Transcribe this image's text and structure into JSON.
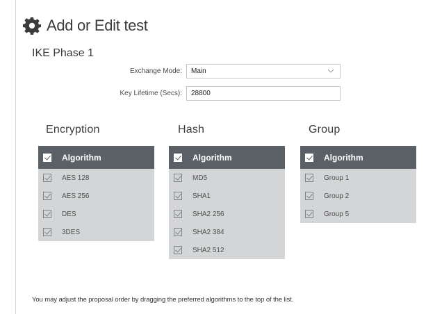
{
  "page": {
    "title": "Add or Edit test",
    "section_title": "IKE Phase 1",
    "footer_note": "You may adjust the proposal order by dragging the preferred algorithms to the top of the list."
  },
  "fields": {
    "exchange_mode_label": "Exchange Mode:",
    "exchange_mode_value": "Main",
    "key_lifetime_label": "Key Lifetime (Secs):",
    "key_lifetime_value": "28800"
  },
  "groups": {
    "encryption": {
      "heading": "Encryption",
      "column_header": "Algorithm",
      "items": [
        "AES 128",
        "AES 256",
        "DES",
        "3DES"
      ]
    },
    "hash": {
      "heading": "Hash",
      "column_header": "Algorithm",
      "items": [
        "MD5",
        "SHA1",
        "SHA2 256",
        "SHA2 384",
        "SHA2 512"
      ]
    },
    "group": {
      "heading": "Group",
      "column_header": "Algorithm",
      "items": [
        "Group 1",
        "Group 2",
        "Group 5"
      ]
    }
  },
  "icons": {
    "title": "gear-icon",
    "dropdown": "chevron-down-icon",
    "checkbox": "checkbox-checked-icon"
  },
  "colors": {
    "table_header_bg": "#5b6066",
    "table_body_bg": "#d3d5d7",
    "heading_text": "#3c3c3c"
  }
}
